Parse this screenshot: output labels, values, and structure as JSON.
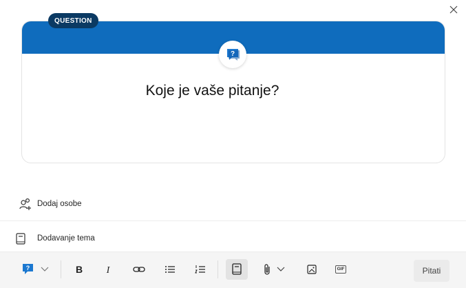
{
  "dialog": {
    "badge": "QUESTION",
    "prompt": "Koje je vaše pitanje?"
  },
  "rows": {
    "add_people": "Dodaj osobe",
    "add_topics": "Dodavanje tema"
  },
  "toolbar": {
    "submit_label": "Pitati",
    "gif_label": "GIF"
  },
  "colors": {
    "banner": "#0f6cbd",
    "badge": "#0b3a63",
    "toolbar_bg": "#f5f5f5"
  }
}
